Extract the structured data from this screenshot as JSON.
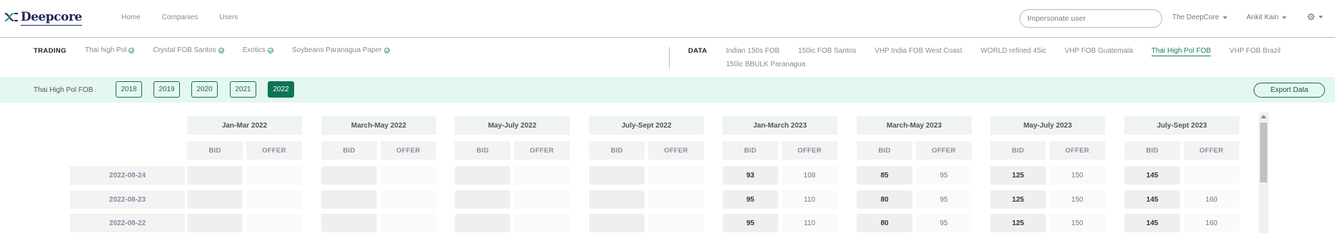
{
  "header": {
    "logo_text": "Deepcore",
    "nav": [
      "Home",
      "Companies",
      "Users"
    ],
    "search_placeholder": "Impersonate user",
    "org_dropdown": "The DeepCore",
    "user_dropdown": "Ankit Kain",
    "settings_icon": "gear-icon"
  },
  "trading": {
    "label": "TRADING",
    "items": [
      "Thai high Pol",
      "Crystal FOB Santos",
      "Exotics",
      "Soybeans Paranagua Paper"
    ]
  },
  "data_nav": {
    "label": "DATA",
    "items": [
      "Indian 150s FOB",
      "150ic FOB Santos",
      "VHP India FOB West Coast",
      "WORLD refined 45ic",
      "VHP FOB Guatemala",
      "Thai High Pol FOB",
      "VHP FOB Brazil",
      "150ic BBULK Paranagua"
    ],
    "active": "Thai High Pol FOB"
  },
  "yearbar": {
    "title": "Thai High Pol FOB",
    "years": [
      "2018",
      "2019",
      "2020",
      "2021",
      "2022"
    ],
    "active_year": "2022",
    "export_label": "Export Data"
  },
  "table": {
    "bid_label": "BID",
    "offer_label": "OFFER",
    "periods": [
      "Jan-Mar 2022",
      "March-May 2022",
      "May-July 2022",
      "July-Sept 2022",
      "Jan-March 2023",
      "March-May 2023",
      "May-July 2023",
      "July-Sept 2023"
    ],
    "rows": [
      {
        "date": "2022-08-24",
        "cells": [
          [
            "",
            ""
          ],
          [
            "",
            ""
          ],
          [
            "",
            ""
          ],
          [
            "",
            ""
          ],
          [
            "93",
            "108"
          ],
          [
            "85",
            "95"
          ],
          [
            "125",
            "150"
          ],
          [
            "145",
            ""
          ]
        ]
      },
      {
        "date": "2022-08-23",
        "cells": [
          [
            "",
            ""
          ],
          [
            "",
            ""
          ],
          [
            "",
            ""
          ],
          [
            "",
            ""
          ],
          [
            "95",
            "110"
          ],
          [
            "80",
            "95"
          ],
          [
            "125",
            "150"
          ],
          [
            "145",
            "160"
          ]
        ]
      },
      {
        "date": "2022-08-22",
        "cells": [
          [
            "",
            ""
          ],
          [
            "",
            ""
          ],
          [
            "",
            ""
          ],
          [
            "",
            ""
          ],
          [
            "95",
            "110"
          ],
          [
            "80",
            "95"
          ],
          [
            "125",
            "150"
          ],
          [
            "145",
            "160"
          ]
        ]
      }
    ]
  },
  "colors": {
    "accent": "#0d7456",
    "yearbar_bg": "#e4f7f1",
    "brand": "#1f2559"
  }
}
